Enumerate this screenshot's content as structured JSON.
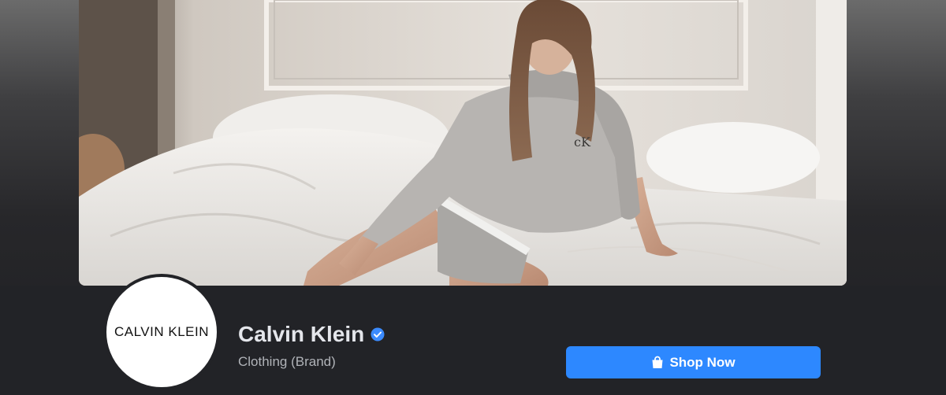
{
  "page": {
    "name": "Calvin Klein",
    "category": "Clothing (Brand)",
    "verified_icon": "verified-badge-icon",
    "verified_color": "#3b8bff"
  },
  "avatar": {
    "logo_text": "CALVIN KLEIN"
  },
  "cover": {
    "sweatshirt_logo": "cK"
  },
  "actions": {
    "shop_label": "Shop Now",
    "shop_icon": "shopping-bag-icon",
    "shop_color": "#2d88ff"
  }
}
